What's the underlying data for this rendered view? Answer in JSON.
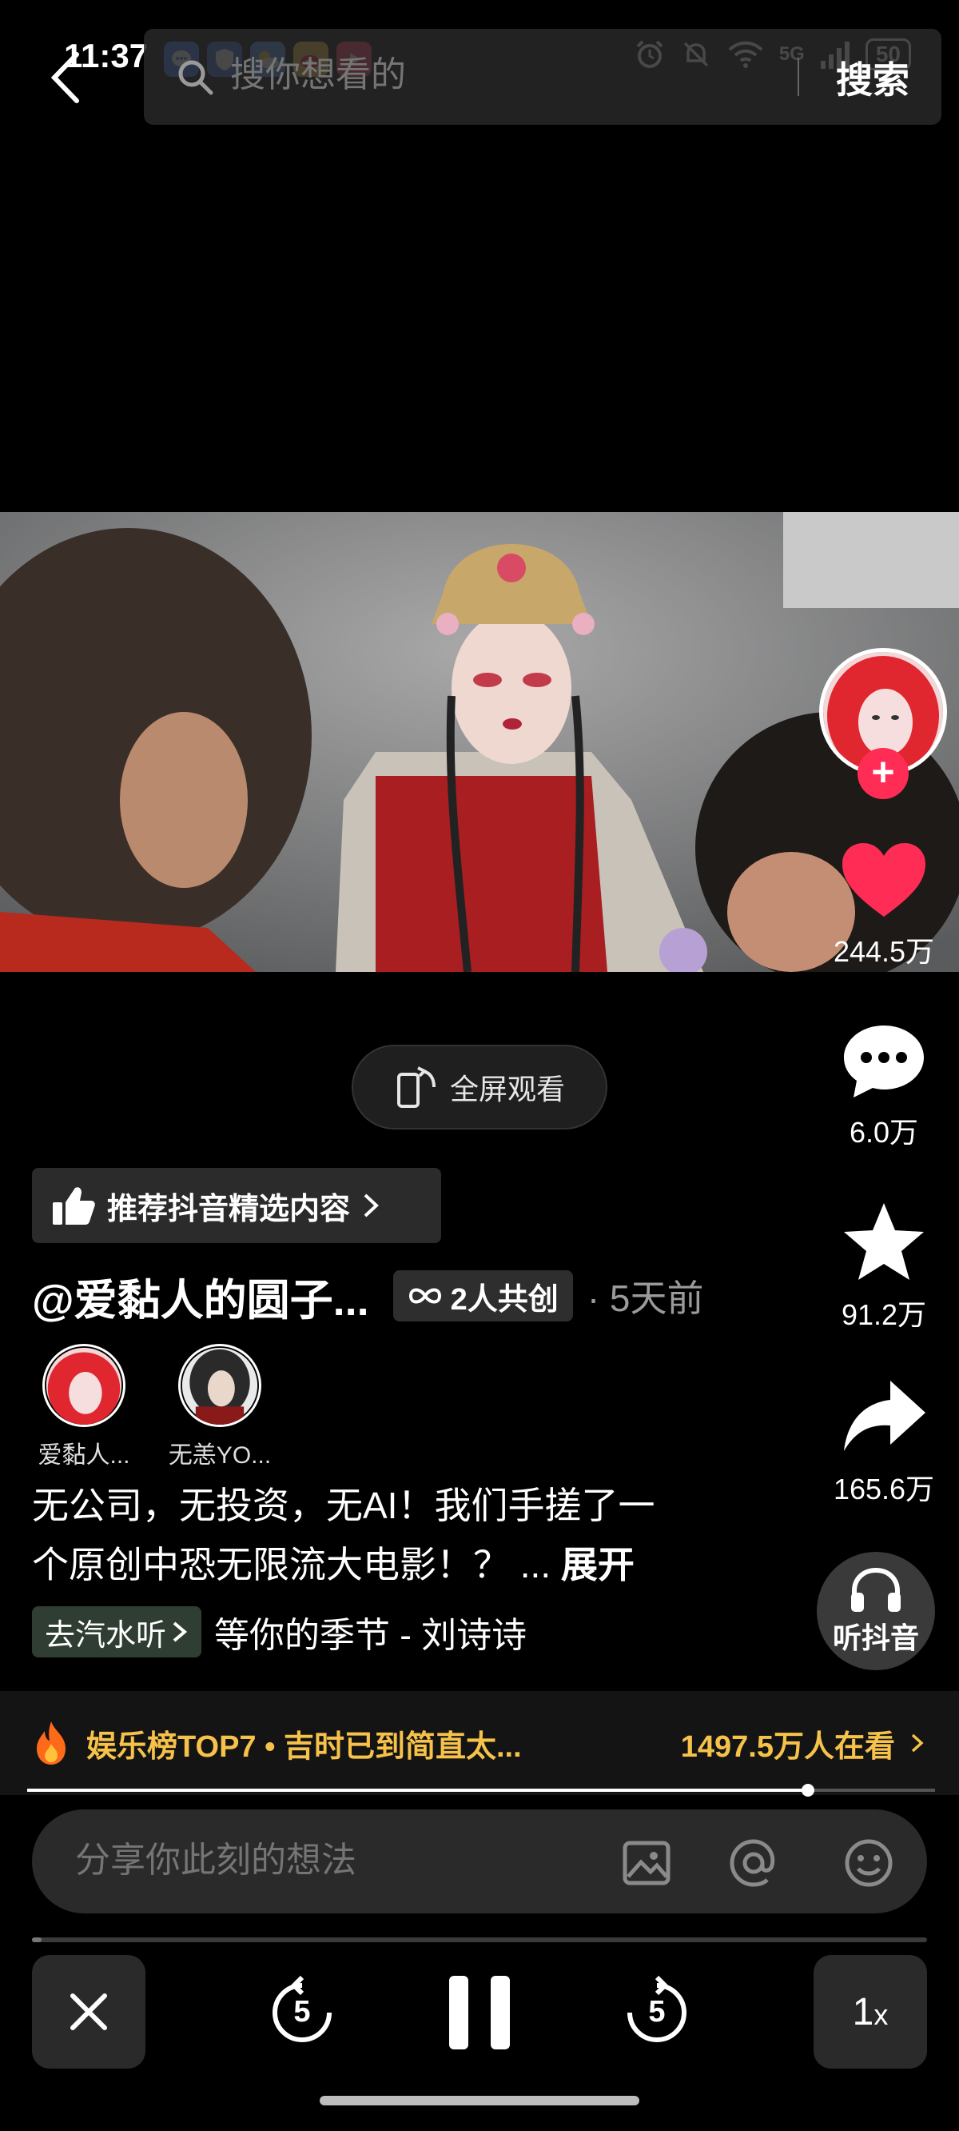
{
  "status_bar": {
    "time": "11:37",
    "network": "5G",
    "battery": "50"
  },
  "search": {
    "placeholder": "搜你想看的",
    "button_label": "搜索"
  },
  "video": {
    "fullscreen_label": "全屏观看"
  },
  "recommend": {
    "label": "推荐抖音精选内容"
  },
  "author": {
    "name": "@爱黏人的圆子...",
    "co_create_label": "2人共创",
    "time_ago": "· 5天前"
  },
  "coauthors": [
    {
      "name": "爱黏人..."
    },
    {
      "name": "无恙YO..."
    }
  ],
  "description": {
    "line1": "无公司，无投资，无AI！我们手搓了一",
    "line2": "个原创中恐无限流大电影！？ ...",
    "expand_label": "展开"
  },
  "music": {
    "tag_label": "去汽水听",
    "song": "等你的季节 - 刘诗诗"
  },
  "actions": {
    "likes": "244.5万",
    "comments": "6.0万",
    "favorites": "91.2万",
    "shares": "165.6万",
    "listen_label": "听抖音"
  },
  "trend": {
    "title": "娱乐榜TOP7 • 吉时已到简直太...",
    "viewers": "1497.5万人在看"
  },
  "video_progress": 0.86,
  "comment": {
    "placeholder": "分享你此刻的想法"
  },
  "player": {
    "rewind_seconds": "5",
    "forward_seconds": "5",
    "speed": "1",
    "speed_unit": "x",
    "progress": 0.01
  },
  "colors": {
    "like_red": "#ff2c55",
    "trend_gold": "#f6c24a",
    "background": "#000000"
  }
}
